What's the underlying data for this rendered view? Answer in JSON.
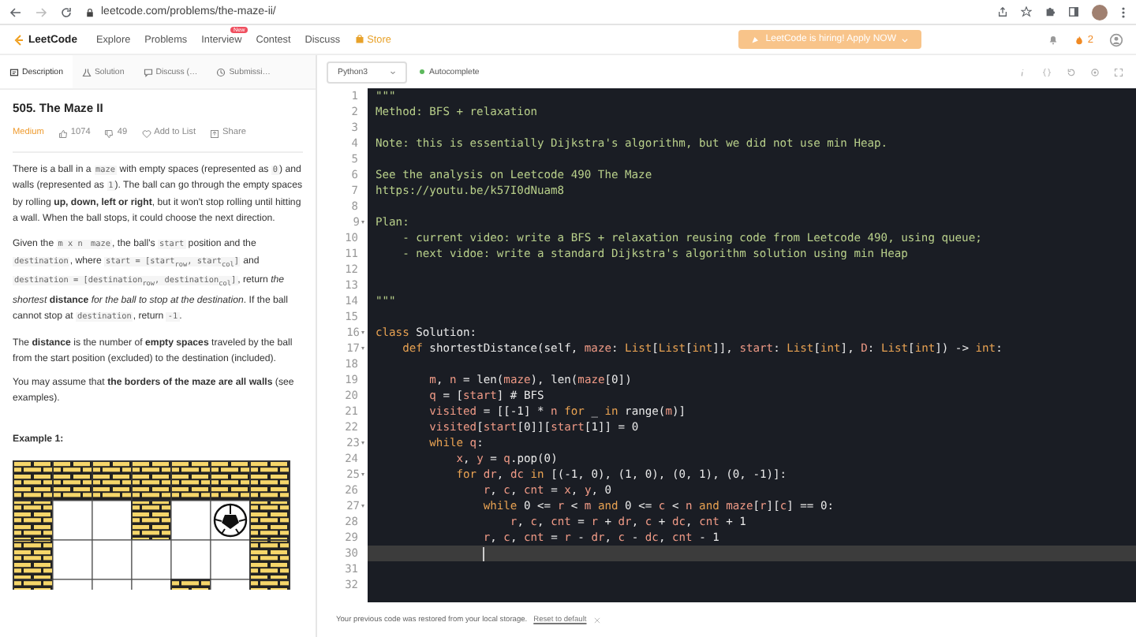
{
  "browser": {
    "url": "leetcode.com/problems/the-maze-ii/"
  },
  "nav": {
    "logo": "LeetCode",
    "items": [
      {
        "label": "Explore",
        "kind": "link"
      },
      {
        "label": "Problems",
        "kind": "link"
      },
      {
        "label": "Interview",
        "kind": "link",
        "badge": "New"
      },
      {
        "label": "Contest",
        "kind": "link"
      },
      {
        "label": "Discuss",
        "kind": "link"
      },
      {
        "label": "Store",
        "kind": "store"
      }
    ],
    "banner": "LeetCode is hiring! Apply NOW",
    "coins": "2"
  },
  "left_tabs": [
    {
      "label": "Description",
      "kind": "doc",
      "selected": true
    },
    {
      "label": "Solution",
      "kind": "flask",
      "selected": false
    },
    {
      "label": "Discuss (…",
      "kind": "chat",
      "selected": false
    },
    {
      "label": "Submissi…",
      "kind": "clock",
      "selected": false
    }
  ],
  "problem": {
    "title": "505. The Maze II",
    "difficulty": "Medium",
    "likes": "1074",
    "dislikes": "49",
    "add_to_list": "Add to List",
    "share": "Share",
    "paragraphs": [
      [
        {
          "kind": "text",
          "text": "There is a ball in a "
        },
        {
          "kind": "code",
          "text": "maze"
        },
        {
          "kind": "text",
          "text": " with empty spaces (represented as "
        },
        {
          "kind": "code",
          "text": "0"
        },
        {
          "kind": "text",
          "text": ") and walls (represented as "
        },
        {
          "kind": "code",
          "text": "1"
        },
        {
          "kind": "text",
          "text": "). The ball can go through the empty spaces by rolling **up, down, left or right**, but it won't stop rolling until hitting a wall. When the ball stops, it could choose the next direction."
        }
      ],
      [
        {
          "kind": "text",
          "text": "Given the "
        },
        {
          "kind": "code",
          "text": "m x n "
        },
        {
          "kind": "code",
          "text": "maze"
        },
        {
          "kind": "text",
          "text": ", the ball's "
        },
        {
          "kind": "code",
          "text": "start"
        },
        {
          "kind": "text",
          "text": " position and the "
        },
        {
          "kind": "code",
          "text": "destination"
        },
        {
          "kind": "text",
          "text": ", where "
        },
        {
          "kind": "code",
          "text": "start = [start$_{row}$, start$_{col}$]"
        },
        {
          "kind": "text",
          "text": " and "
        },
        {
          "kind": "code",
          "text": "destination = [destination$_{row}$, destination$_{col}$]"
        },
        {
          "kind": "text",
          "text": ", return *the shortest* **distance** *for the ball to stop at the destination*. If the ball cannot stop at "
        },
        {
          "kind": "code",
          "text": "destination"
        },
        {
          "kind": "text",
          "text": ", return "
        },
        {
          "kind": "code",
          "text": "-1"
        },
        {
          "kind": "text",
          "text": "."
        }
      ],
      [
        {
          "kind": "text",
          "text": "The **distance** is the number of **empty spaces** traveled by the ball from the start position (excluded) to the destination (included)."
        }
      ],
      [
        {
          "kind": "text",
          "text": "You may assume that **the borders of the maze are all walls** (see examples)."
        }
      ]
    ],
    "example_title": "Example 1:",
    "maze": [
      [
        {
          "kind": "wall"
        },
        {
          "kind": "wall"
        },
        {
          "kind": "wall"
        },
        {
          "kind": "wall"
        },
        {
          "kind": "wall"
        },
        {
          "kind": "wall"
        },
        {
          "kind": "wall"
        }
      ],
      [
        {
          "kind": "wall"
        },
        {
          "kind": "empty"
        },
        {
          "kind": "empty"
        },
        {
          "kind": "wall"
        },
        {
          "kind": "empty"
        },
        {
          "kind": "ball"
        },
        {
          "kind": "wall"
        }
      ],
      [
        {
          "kind": "wall"
        },
        {
          "kind": "empty"
        },
        {
          "kind": "empty"
        },
        {
          "kind": "empty"
        },
        {
          "kind": "empty"
        },
        {
          "kind": "empty"
        },
        {
          "kind": "wall"
        }
      ],
      [
        {
          "kind": "wall"
        },
        {
          "kind": "empty"
        },
        {
          "kind": "empty"
        },
        {
          "kind": "empty"
        },
        {
          "kind": "wall"
        },
        {
          "kind": "empty"
        },
        {
          "kind": "wall"
        }
      ]
    ]
  },
  "editor": {
    "language": "Python3",
    "autocomplete": "Autocomplete",
    "lines": [
      {
        "n": "1",
        "fold": false,
        "active": false,
        "parts": [
          {
            "kind": "doc",
            "text": "\"\"\""
          }
        ]
      },
      {
        "n": "2",
        "fold": false,
        "active": false,
        "parts": [
          {
            "kind": "doc",
            "text": "Method: BFS + relaxation"
          }
        ]
      },
      {
        "n": "3",
        "fold": false,
        "active": false
      },
      {
        "n": "4",
        "fold": false,
        "active": false,
        "parts": [
          {
            "kind": "doc",
            "text": "Note: this is essentially Dijkstra's algorithm, but we did not use min Heap."
          }
        ]
      },
      {
        "n": "5",
        "fold": false,
        "active": false
      },
      {
        "n": "6",
        "fold": false,
        "active": false,
        "parts": [
          {
            "kind": "doc",
            "text": "See the analysis on Leetcode 490 The Maze"
          }
        ]
      },
      {
        "n": "7",
        "fold": false,
        "active": false,
        "parts": [
          {
            "kind": "doc",
            "text": "https://youtu.be/k57I0dNuam8"
          }
        ]
      },
      {
        "n": "8",
        "fold": false,
        "active": false
      },
      {
        "n": "9",
        "fold": true,
        "active": false,
        "parts": [
          {
            "kind": "doc",
            "text": "Plan:"
          }
        ]
      },
      {
        "n": "10",
        "fold": false,
        "active": false,
        "parts": [
          {
            "kind": "doc",
            "text": "    - current video: write a BFS + relaxation reusing code from Leetcode 490, using queue;"
          }
        ]
      },
      {
        "n": "11",
        "fold": false,
        "active": false,
        "parts": [
          {
            "kind": "doc",
            "text": "    - next vidoe: write a standard Dijkstra's algorithm solution using min Heap"
          }
        ]
      },
      {
        "n": "12",
        "fold": false,
        "active": false
      },
      {
        "n": "13",
        "fold": false,
        "active": false
      },
      {
        "n": "14",
        "fold": false,
        "active": false,
        "parts": [
          {
            "kind": "doc",
            "text": "\"\"\""
          }
        ]
      },
      {
        "n": "15",
        "fold": false,
        "active": false
      },
      {
        "n": "16",
        "fold": true,
        "active": false,
        "parts": [
          {
            "kind": "kw",
            "text": "class"
          },
          {
            "kind": "txt",
            "text": " Solution:"
          }
        ]
      },
      {
        "n": "17",
        "fold": true,
        "active": false,
        "parts": [
          {
            "kind": "kw",
            "text": "    def"
          },
          {
            "kind": "txt",
            "text": " shortestDistance(self, "
          },
          {
            "kind": "var",
            "text": "maze"
          },
          {
            "kind": "txt",
            "text": ": "
          },
          {
            "kind": "kw",
            "text": "List"
          },
          {
            "kind": "txt",
            "text": "["
          },
          {
            "kind": "kw",
            "text": "List"
          },
          {
            "kind": "txt",
            "text": "["
          },
          {
            "kind": "kw",
            "text": "int"
          },
          {
            "kind": "txt",
            "text": "]], "
          },
          {
            "kind": "var",
            "text": "start"
          },
          {
            "kind": "txt",
            "text": ": "
          },
          {
            "kind": "kw",
            "text": "List"
          },
          {
            "kind": "txt",
            "text": "["
          },
          {
            "kind": "kw",
            "text": "int"
          },
          {
            "kind": "txt",
            "text": "], "
          },
          {
            "kind": "var",
            "text": "D"
          },
          {
            "kind": "txt",
            "text": ": "
          },
          {
            "kind": "kw",
            "text": "List"
          },
          {
            "kind": "txt",
            "text": "["
          },
          {
            "kind": "kw",
            "text": "int"
          },
          {
            "kind": "txt",
            "text": "]) -> "
          },
          {
            "kind": "kw",
            "text": "int"
          },
          {
            "kind": "txt",
            "text": ":"
          }
        ]
      },
      {
        "n": "18",
        "fold": false,
        "active": false
      },
      {
        "n": "19",
        "fold": false,
        "active": false,
        "parts": [
          {
            "kind": "var",
            "text": "        m"
          },
          {
            "kind": "txt",
            "text": ", "
          },
          {
            "kind": "var",
            "text": "n"
          },
          {
            "kind": "txt",
            "text": " = len("
          },
          {
            "kind": "var",
            "text": "maze"
          },
          {
            "kind": "txt",
            "text": "), len("
          },
          {
            "kind": "var",
            "text": "maze"
          },
          {
            "kind": "txt",
            "text": "[0])"
          }
        ]
      },
      {
        "n": "20",
        "fold": false,
        "active": false,
        "parts": [
          {
            "kind": "var",
            "text": "        q"
          },
          {
            "kind": "txt",
            "text": " = ["
          },
          {
            "kind": "var",
            "text": "start"
          },
          {
            "kind": "txt",
            "text": "] # BFS"
          }
        ]
      },
      {
        "n": "21",
        "fold": false,
        "active": false,
        "parts": [
          {
            "kind": "var",
            "text": "        visited"
          },
          {
            "kind": "txt",
            "text": " = [[-1] * "
          },
          {
            "kind": "var",
            "text": "n"
          },
          {
            "kind": "kw",
            "text": " for"
          },
          {
            "kind": "txt",
            "text": " _ "
          },
          {
            "kind": "kw",
            "text": "in"
          },
          {
            "kind": "txt",
            "text": " range("
          },
          {
            "kind": "var",
            "text": "m"
          },
          {
            "kind": "txt",
            "text": ")]"
          }
        ]
      },
      {
        "n": "22",
        "fold": false,
        "active": false,
        "parts": [
          {
            "kind": "var",
            "text": "        visited"
          },
          {
            "kind": "txt",
            "text": "["
          },
          {
            "kind": "var",
            "text": "start"
          },
          {
            "kind": "txt",
            "text": "[0]]["
          },
          {
            "kind": "var",
            "text": "start"
          },
          {
            "kind": "txt",
            "text": "[1]] = 0"
          }
        ]
      },
      {
        "n": "23",
        "fold": true,
        "active": false,
        "parts": [
          {
            "kind": "kw",
            "text": "        while "
          },
          {
            "kind": "var",
            "text": "q"
          },
          {
            "kind": "txt",
            "text": ":"
          }
        ]
      },
      {
        "n": "24",
        "fold": false,
        "active": false,
        "parts": [
          {
            "kind": "var",
            "text": "            x"
          },
          {
            "kind": "txt",
            "text": ", "
          },
          {
            "kind": "var",
            "text": "y"
          },
          {
            "kind": "txt",
            "text": " = "
          },
          {
            "kind": "var",
            "text": "q"
          },
          {
            "kind": "txt",
            "text": ".pop(0)"
          }
        ]
      },
      {
        "n": "25",
        "fold": true,
        "active": false,
        "parts": [
          {
            "kind": "kw",
            "text": "            for "
          },
          {
            "kind": "var",
            "text": "dr"
          },
          {
            "kind": "txt",
            "text": ", "
          },
          {
            "kind": "var",
            "text": "dc"
          },
          {
            "kind": "kw",
            "text": " in"
          },
          {
            "kind": "txt",
            "text": " [(-1, 0), (1, 0), (0, 1), (0, -1)]:"
          }
        ]
      },
      {
        "n": "26",
        "fold": false,
        "active": false,
        "parts": [
          {
            "kind": "var",
            "text": "                r"
          },
          {
            "kind": "txt",
            "text": ", "
          },
          {
            "kind": "var",
            "text": "c"
          },
          {
            "kind": "txt",
            "text": ", "
          },
          {
            "kind": "var",
            "text": "cnt"
          },
          {
            "kind": "txt",
            "text": " = "
          },
          {
            "kind": "var",
            "text": "x"
          },
          {
            "kind": "txt",
            "text": ", "
          },
          {
            "kind": "var",
            "text": "y"
          },
          {
            "kind": "txt",
            "text": ", 0"
          }
        ]
      },
      {
        "n": "27",
        "fold": true,
        "active": false,
        "parts": [
          {
            "kind": "kw",
            "text": "                while"
          },
          {
            "kind": "txt",
            "text": " 0 <= "
          },
          {
            "kind": "var",
            "text": "r"
          },
          {
            "kind": "txt",
            "text": " < "
          },
          {
            "kind": "var",
            "text": "m"
          },
          {
            "kind": "kw",
            "text": " and"
          },
          {
            "kind": "txt",
            "text": " 0 <= "
          },
          {
            "kind": "var",
            "text": "c"
          },
          {
            "kind": "txt",
            "text": " < "
          },
          {
            "kind": "var",
            "text": "n"
          },
          {
            "kind": "kw",
            "text": " and "
          },
          {
            "kind": "var",
            "text": "maze"
          },
          {
            "kind": "txt",
            "text": "["
          },
          {
            "kind": "var",
            "text": "r"
          },
          {
            "kind": "txt",
            "text": "]["
          },
          {
            "kind": "var",
            "text": "c"
          },
          {
            "kind": "txt",
            "text": "] == 0:"
          }
        ]
      },
      {
        "n": "28",
        "fold": false,
        "active": false,
        "parts": [
          {
            "kind": "var",
            "text": "                    r"
          },
          {
            "kind": "txt",
            "text": ", "
          },
          {
            "kind": "var",
            "text": "c"
          },
          {
            "kind": "txt",
            "text": ", "
          },
          {
            "kind": "var",
            "text": "cnt"
          },
          {
            "kind": "txt",
            "text": " = "
          },
          {
            "kind": "var",
            "text": "r"
          },
          {
            "kind": "txt",
            "text": " + "
          },
          {
            "kind": "var",
            "text": "dr"
          },
          {
            "kind": "txt",
            "text": ", "
          },
          {
            "kind": "var",
            "text": "c"
          },
          {
            "kind": "txt",
            "text": " + "
          },
          {
            "kind": "var",
            "text": "dc"
          },
          {
            "kind": "txt",
            "text": ", "
          },
          {
            "kind": "var",
            "text": "cnt"
          },
          {
            "kind": "txt",
            "text": " + 1"
          }
        ]
      },
      {
        "n": "29",
        "fold": false,
        "active": false,
        "parts": [
          {
            "kind": "var",
            "text": "                r"
          },
          {
            "kind": "txt",
            "text": ", "
          },
          {
            "kind": "var",
            "text": "c"
          },
          {
            "kind": "txt",
            "text": ", "
          },
          {
            "kind": "var",
            "text": "cnt"
          },
          {
            "kind": "txt",
            "text": " = "
          },
          {
            "kind": "var",
            "text": "r"
          },
          {
            "kind": "txt",
            "text": " - "
          },
          {
            "kind": "var",
            "text": "dr"
          },
          {
            "kind": "txt",
            "text": ", "
          },
          {
            "kind": "var",
            "text": "c"
          },
          {
            "kind": "txt",
            "text": " - "
          },
          {
            "kind": "var",
            "text": "dc"
          },
          {
            "kind": "txt",
            "text": ", "
          },
          {
            "kind": "var",
            "text": "cnt"
          },
          {
            "kind": "txt",
            "text": " - 1"
          }
        ]
      },
      {
        "n": "30",
        "fold": false,
        "active": true
      },
      {
        "n": "31",
        "fold": false,
        "active": false
      },
      {
        "n": "32",
        "fold": false,
        "active": false
      }
    ]
  },
  "notice": {
    "text": "Your previous code was restored from your local storage.",
    "link": "Reset to default"
  }
}
